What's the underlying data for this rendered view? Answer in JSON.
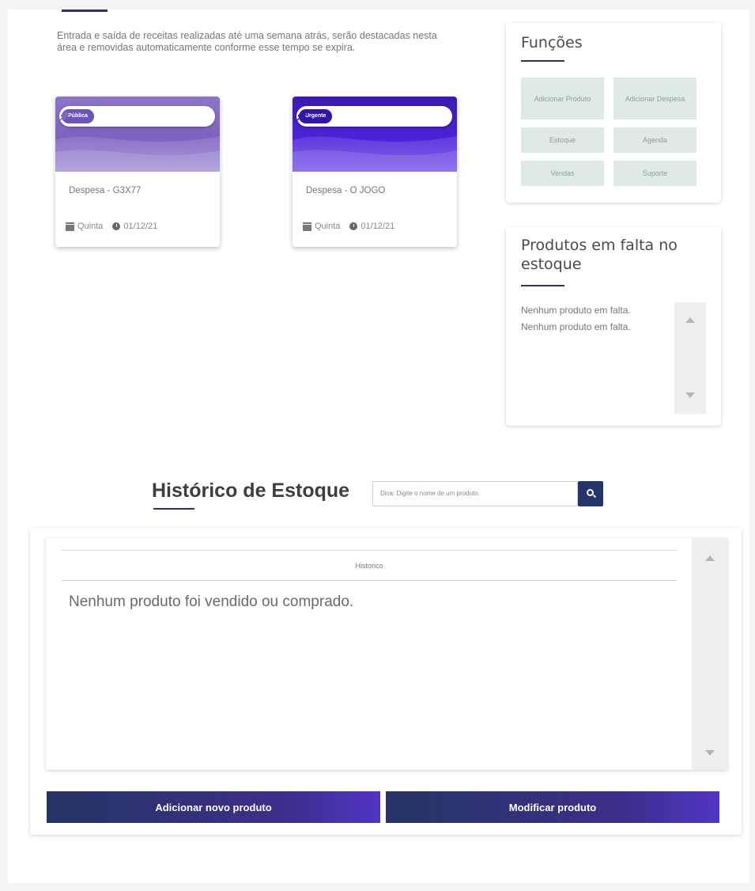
{
  "intro": {
    "text": "Entrada e saída de receitas realizadas até uma semana atrás, serão destacadas nesta área e removidas automaticamente conforme esse tempo se expira."
  },
  "cards": [
    {
      "tag": "Pública",
      "title": "Despesa - G3X77",
      "day": "Quinta",
      "date": "01/12/21"
    },
    {
      "tag": "Urgente",
      "title": "Despesa - O JOGO",
      "day": "Quinta",
      "date": "01/12/21"
    }
  ],
  "functions": {
    "title": "Funções",
    "buttons": [
      "Adicionar Produto",
      "Adicionar Despesa",
      "Estoque",
      "Agenda",
      "Vendas",
      "Suporte"
    ]
  },
  "stock": {
    "title": "Produtos em falta no estoque",
    "items": [
      "Nenhum produto em falta.",
      "Nenhum produto em falta."
    ]
  },
  "history": {
    "title": "Histórico de Estoque",
    "search_placeholder": "Dica: Digite o nome de um produto.",
    "column_header": "Historico",
    "empty_message": "Nenhum produto foi vendido ou comprado.",
    "add_label": "Adicionar novo produto",
    "modify_label": "Modificar produto"
  },
  "colors": {
    "accent": "#3a2d6e",
    "button_start": "#253463",
    "button_end": "#5234c4",
    "function_bg": "#dfe9e6"
  }
}
